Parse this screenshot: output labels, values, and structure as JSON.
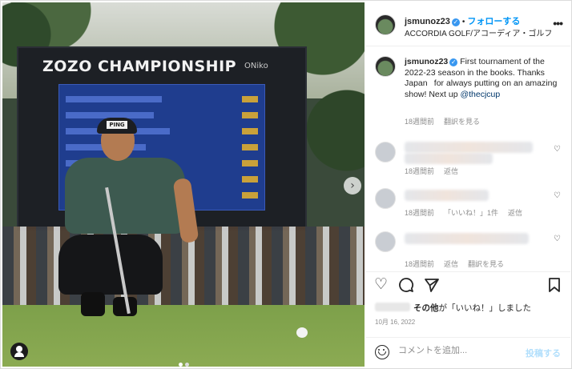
{
  "photo": {
    "scoreboard_title": "ZOZO CHAMPIONSHIP",
    "scoreboard_sub": "ONiko",
    "cap_logo": "PING",
    "next_arrow": "›",
    "slide_count": 2
  },
  "post": {
    "header": {
      "username": "jsmunoz23",
      "verified_mark": "✓",
      "separator": "•",
      "follow_label": "フォローする",
      "location": "ACCORDIA GOLF/アコーディア・ゴルフ",
      "more_icon": "more-horizontal-icon"
    },
    "caption": {
      "username": "jsmunoz23",
      "text_before_mention": "First tournament of the 2022-23 season in the books. Thanks Japan  for always putting on an amazing show! Next up ",
      "mention": "@thecjcup",
      "time": "18週間前",
      "translate": "翻訳を見る"
    },
    "comments": [
      {
        "time": "18週間前",
        "reply": "返信"
      },
      {
        "time": "18週間前",
        "likes": "「いいね！」1件",
        "reply": "返信"
      },
      {
        "time": "18週間前",
        "reply": "返信",
        "translate": "翻訳を見る"
      }
    ],
    "likes": {
      "others": "その他",
      "suffix": "が「いいね！」しました"
    },
    "date": "10月 16, 2022",
    "comment_placeholder": "コメントを追加...",
    "post_label": "投稿する"
  },
  "colors": {
    "accent_blue": "#0095f6",
    "post_disabled": "#b2dffc",
    "verified": "#3897f0"
  }
}
